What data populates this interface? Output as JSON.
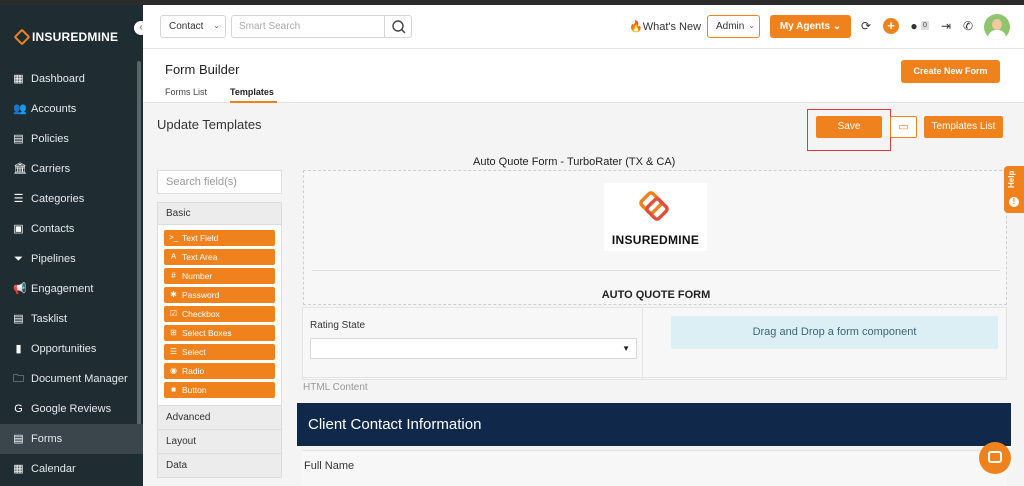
{
  "brand": {
    "name": "INSUREDMINE",
    "accent": "#f0821e",
    "sidebar_bg": "#1f2d33",
    "banner_bg": "#10284a"
  },
  "sidebar": {
    "items": [
      {
        "label": "Dashboard",
        "icon": "dashboard-icon",
        "glyph": "▦"
      },
      {
        "label": "Accounts",
        "icon": "accounts-icon",
        "glyph": "👥"
      },
      {
        "label": "Policies",
        "icon": "policies-icon",
        "glyph": "▤"
      },
      {
        "label": "Carriers",
        "icon": "carriers-icon",
        "glyph": "🏛"
      },
      {
        "label": "Categories",
        "icon": "categories-icon",
        "glyph": "☰"
      },
      {
        "label": "Contacts",
        "icon": "contacts-icon",
        "glyph": "▣"
      },
      {
        "label": "Pipelines",
        "icon": "pipelines-icon",
        "glyph": "⏷"
      },
      {
        "label": "Engagement",
        "icon": "engagement-icon",
        "glyph": "📢"
      },
      {
        "label": "Tasklist",
        "icon": "tasklist-icon",
        "glyph": "▤"
      },
      {
        "label": "Opportunities",
        "icon": "opportunities-icon",
        "glyph": "▮"
      },
      {
        "label": "Document Manager",
        "icon": "folder-icon",
        "glyph": "🗀"
      },
      {
        "label": "Google Reviews",
        "icon": "google-icon",
        "glyph": "G"
      },
      {
        "label": "Forms",
        "icon": "forms-icon",
        "glyph": "▤"
      },
      {
        "label": "Calendar",
        "icon": "calendar-icon",
        "glyph": "▦"
      }
    ],
    "active": "Forms"
  },
  "topbar": {
    "contact_select": "Contact",
    "search_placeholder": "Smart Search",
    "whats_new": "What's New",
    "admin": "Admin",
    "my_agents": "My Agents",
    "badge_count": "0"
  },
  "header": {
    "title": "Form Builder",
    "tabs": [
      "Forms List",
      "Templates"
    ],
    "active_tab": "Templates",
    "create_button": "Create New Form"
  },
  "content": {
    "title": "Update Templates",
    "save": "Save",
    "templates_list": "Templates List",
    "field_search_placeholder": "Search field(s)",
    "groups": {
      "basic": "Basic",
      "advanced": "Advanced",
      "layout": "Layout",
      "data": "Data"
    },
    "components": [
      {
        "label": "Text Field",
        "glyph": ">_"
      },
      {
        "label": "Text Area",
        "glyph": "A"
      },
      {
        "label": "Number",
        "glyph": "#"
      },
      {
        "label": "Password",
        "glyph": "✱"
      },
      {
        "label": "Checkbox",
        "glyph": "☑"
      },
      {
        "label": "Select Boxes",
        "glyph": "⊞"
      },
      {
        "label": "Select",
        "glyph": "☰"
      },
      {
        "label": "Radio",
        "glyph": "◉"
      },
      {
        "label": "Button",
        "glyph": "■"
      }
    ]
  },
  "form": {
    "title": "Auto Quote Form - TurboRater (TX & CA)",
    "logo_text": "INSUREDMINE",
    "heading": "AUTO QUOTE FORM",
    "rating_state_label": "Rating State",
    "dnd_text": "Drag and Drop a form component",
    "html_content_label": "HTML Content",
    "banner": "Client Contact Information",
    "full_name_label": "Full Name"
  },
  "help": {
    "label": "Help"
  }
}
